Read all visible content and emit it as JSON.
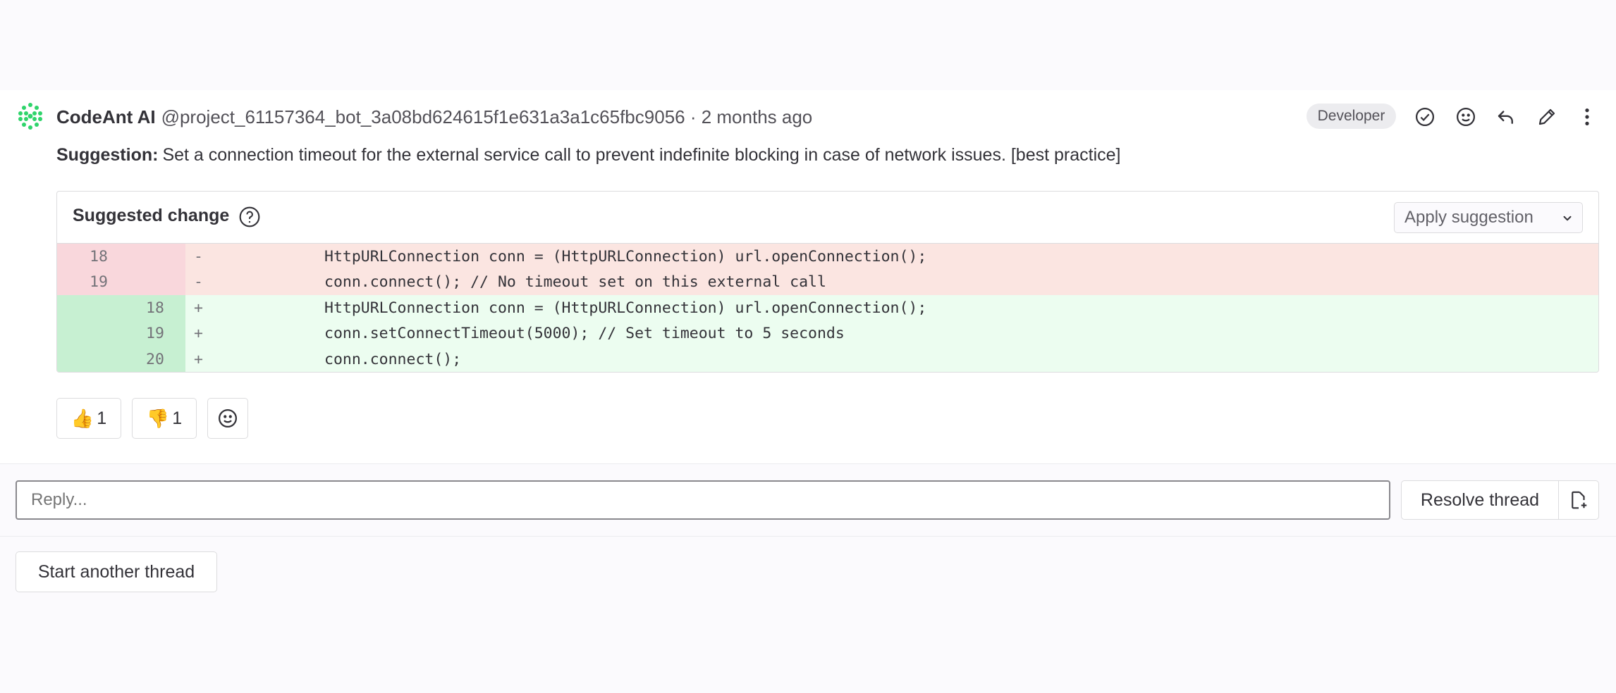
{
  "comment": {
    "author_name": "CodeAnt AI",
    "author_handle": "@project_61157364_bot_3a08bd624615f1e631a3a1c65fbc9056 · 2 months ago",
    "role_badge": "Developer",
    "suggestion_label": "Suggestion:",
    "suggestion_body": "Set a connection timeout for the external service call to prevent indefinite blocking in case of network issues. [best practice]"
  },
  "actions": [
    "check-circle-icon",
    "smiley-icon",
    "reply-icon",
    "pencil-icon",
    "more-vertical-icon"
  ],
  "suggested_change": {
    "title": "Suggested change",
    "apply_label": "Apply suggestion",
    "lines": [
      {
        "type": "del",
        "old": "18",
        "new": "",
        "sign": "-",
        "code": "HttpURLConnection conn = (HttpURLConnection) url.openConnection();"
      },
      {
        "type": "del",
        "old": "19",
        "new": "",
        "sign": "-",
        "code": "conn.connect(); // No timeout set on this external call"
      },
      {
        "type": "add",
        "old": "",
        "new": "18",
        "sign": "+",
        "code": "HttpURLConnection conn = (HttpURLConnection) url.openConnection();"
      },
      {
        "type": "add",
        "old": "",
        "new": "19",
        "sign": "+",
        "code": "conn.setConnectTimeout(5000); // Set timeout to 5 seconds"
      },
      {
        "type": "add",
        "old": "",
        "new": "20",
        "sign": "+",
        "code": "conn.connect();"
      }
    ]
  },
  "reactions": {
    "thumbs_up_emoji": "👍",
    "thumbs_up_count": "1",
    "thumbs_down_emoji": "👎",
    "thumbs_down_count": "1"
  },
  "reply": {
    "placeholder": "Reply...",
    "resolve_label": "Resolve thread"
  },
  "start_thread_label": "Start another thread",
  "colors": {
    "deleted_bg": "#fbe5e1",
    "added_bg": "#ecfdf0",
    "avatar_green": "#2fd46b"
  }
}
